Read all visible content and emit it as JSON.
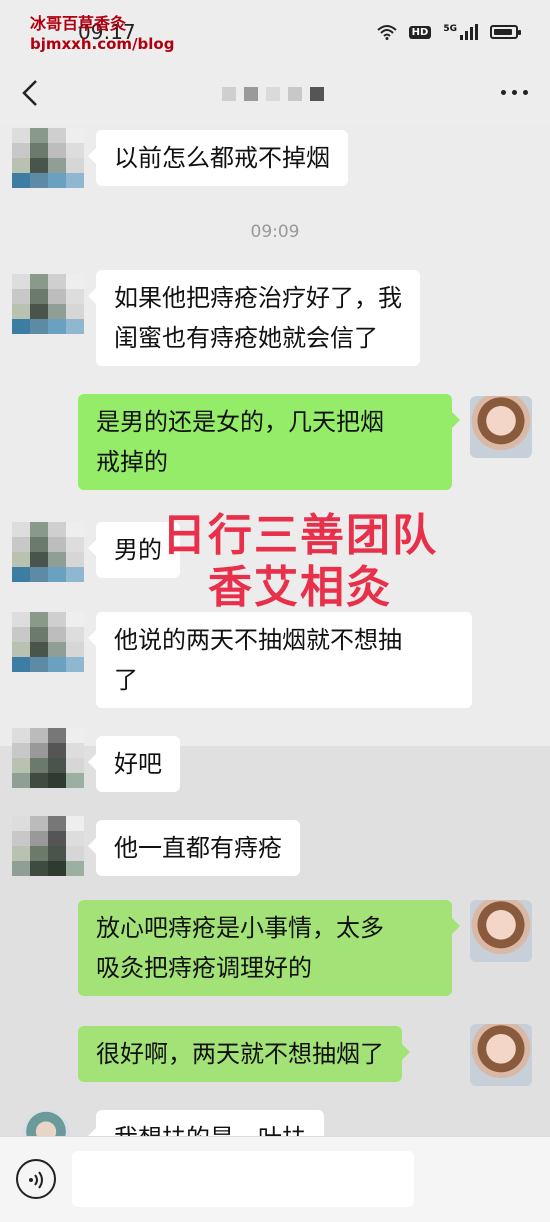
{
  "status_bar": {
    "time": "09:17",
    "watermark_line1": "冰哥百草香灸",
    "watermark_line2": "bjmxxh.com/blog",
    "hd": "HD",
    "network": "5G"
  },
  "nav": {
    "title": "",
    "back_icon": "chevron-left-icon",
    "more_icon": "more-dots-icon"
  },
  "timestamps": [
    "09:09"
  ],
  "messages": [
    {
      "side": "left",
      "text": "以前怎么都戒不掉烟"
    },
    {
      "side": "left",
      "text_line1": "如果他把痔疮治疗好了，我",
      "text_line2": "闺蜜也有痔疮她就会信了"
    },
    {
      "side": "right",
      "text_line1": "是男的还是女的，几天把烟",
      "text_line2": "戒掉的"
    },
    {
      "side": "left",
      "text": "男的"
    },
    {
      "side": "left",
      "text_line1": "他说的两天不抽烟就不想抽",
      "text_line2": "了"
    },
    {
      "side": "left",
      "text": "好吧"
    },
    {
      "side": "left",
      "text": "他一直都有痔疮"
    },
    {
      "side": "right",
      "text_line1": "放心吧痔疮是小事情，太多",
      "text_line2": "吸灸把痔疮调理好的"
    },
    {
      "side": "right",
      "text": "很好啊，两天就不想抽烟了"
    },
    {
      "side": "left",
      "text": "我想扶的是一叶扶"
    }
  ],
  "overlay": {
    "line1": "日行三善团队",
    "line2": "香艾相灸",
    "color": "#e8304a"
  },
  "input_bar": {
    "voice_icon": "voice-icon"
  },
  "colors": {
    "green_bubble": "#95ec69",
    "background": "#ededed"
  }
}
